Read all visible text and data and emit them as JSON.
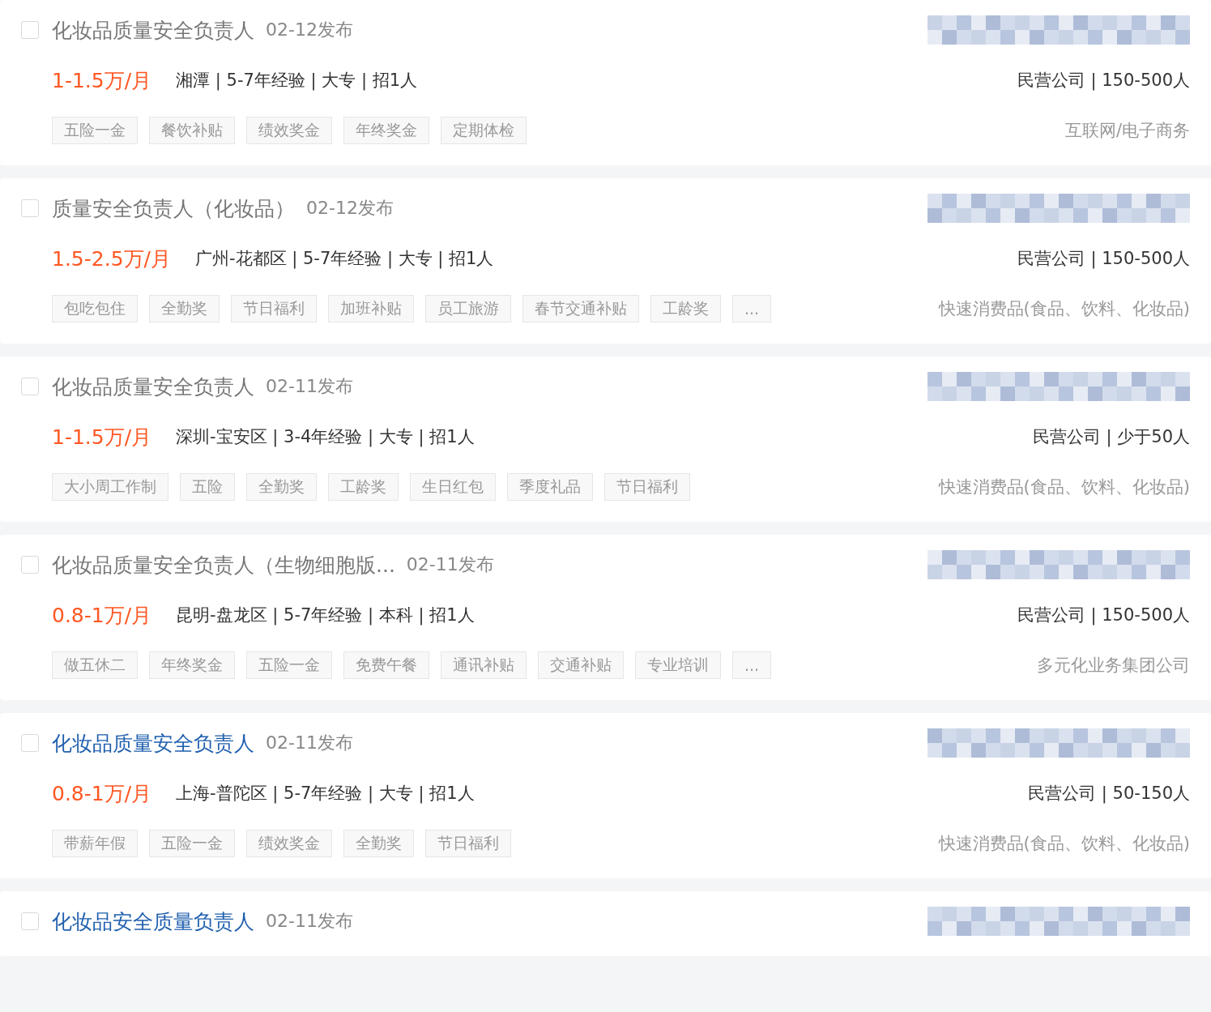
{
  "jobs": [
    {
      "checked": false,
      "visited": true,
      "title": "化妆品质量安全负责人",
      "date": "02-12发布",
      "salary": "1-1.5万/月",
      "details": "湘潭 | 5-7年经验 | 大专 | 招1人",
      "tags": [
        "五险一金",
        "餐饮补贴",
        "绩效奖金",
        "年终奖金",
        "定期体检"
      ],
      "company_info": "民营公司 | 150-500人",
      "industry": "互联网/电子商务"
    },
    {
      "checked": false,
      "visited": true,
      "title": "质量安全负责人（化妆品）",
      "date": "02-12发布",
      "salary": "1.5-2.5万/月",
      "details": "广州-花都区 | 5-7年经验 | 大专 | 招1人",
      "tags": [
        "包吃包住",
        "全勤奖",
        "节日福利",
        "加班补贴",
        "员工旅游",
        "春节交通补贴",
        "工龄奖",
        "..."
      ],
      "company_info": "民营公司 | 150-500人",
      "industry": "快速消费品(食品、饮料、化妆品)"
    },
    {
      "checked": false,
      "visited": true,
      "title": "化妆品质量安全负责人",
      "date": "02-11发布",
      "salary": "1-1.5万/月",
      "details": "深圳-宝安区 | 3-4年经验 | 大专 | 招1人",
      "tags": [
        "大小周工作制",
        "五险",
        "全勤奖",
        "工龄奖",
        "生日红包",
        "季度礼品",
        "节日福利"
      ],
      "company_info": "民营公司 | 少于50人",
      "industry": "快速消费品(食品、饮料、化妆品)"
    },
    {
      "checked": false,
      "visited": true,
      "title": "化妆品质量安全负责人（生物细胞版...",
      "date": "02-11发布",
      "salary": "0.8-1万/月",
      "details": "昆明-盘龙区 | 5-7年经验 | 本科 | 招1人",
      "tags": [
        "做五休二",
        "年终奖金",
        "五险一金",
        "免费午餐",
        "通讯补贴",
        "交通补贴",
        "专业培训",
        "..."
      ],
      "company_info": "民营公司 | 150-500人",
      "industry": "多元化业务集团公司"
    },
    {
      "checked": false,
      "visited": false,
      "title": "化妆品质量安全负责人",
      "date": "02-11发布",
      "salary": "0.8-1万/月",
      "details": "上海-普陀区 | 5-7年经验 | 大专 | 招1人",
      "tags": [
        "带薪年假",
        "五险一金",
        "绩效奖金",
        "全勤奖",
        "节日福利"
      ],
      "company_info": "民营公司 | 50-150人",
      "industry": "快速消费品(食品、饮料、化妆品)"
    },
    {
      "checked": false,
      "visited": false,
      "title": "化妆品安全质量负责人",
      "date": "02-11发布"
    }
  ]
}
